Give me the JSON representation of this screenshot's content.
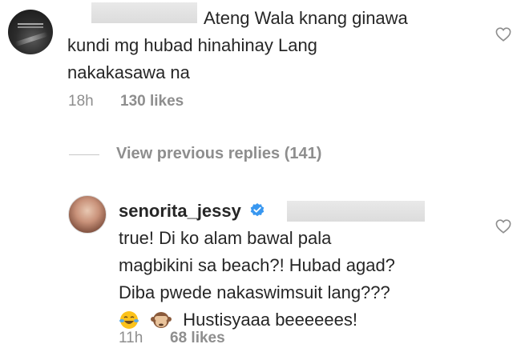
{
  "comment_top": {
    "text_line1": "Ateng Wala knang ginawa",
    "text_line2": "kundi mg hubad hinahinay Lang",
    "text_line3": "nakakasawa na",
    "time": "18h",
    "likes": "130 likes",
    "like_icon": "heart-outline"
  },
  "view_previous": {
    "label": "View previous replies (141)"
  },
  "comment_reply": {
    "username": "senorita_jessy",
    "verified_icon": "verified-badge",
    "text_line1": "true! Di ko alam bawal pala",
    "text_line2": "magbikini sa beach?! Hubad agad?",
    "text_line3": "Diba pwede nakaswimsuit lang???",
    "text_line4_suffix": "Hustisyaaa beeeeees!",
    "emojis": [
      "face-with-tears-of-joy",
      "see-no-evil-monkey"
    ],
    "time": "11h",
    "likes": "68 likes",
    "like_icon": "heart-outline"
  },
  "colors": {
    "text": "#262626",
    "meta": "#8e8e8e",
    "verified": "#3897f0"
  }
}
